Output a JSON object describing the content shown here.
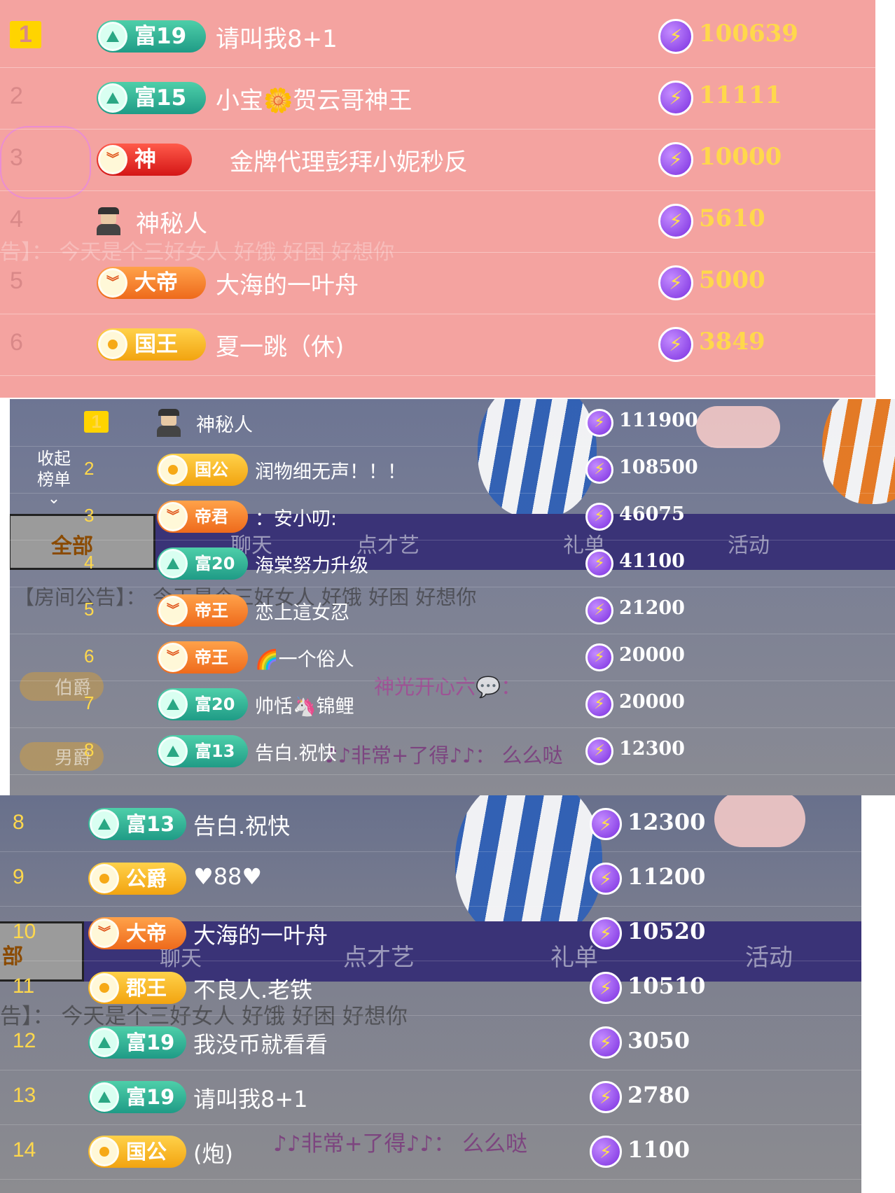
{
  "panel1": {
    "rows": [
      {
        "rank": "1",
        "badge": "富19",
        "badge_style": "teal",
        "name": "请叫我8+1",
        "score": "100639"
      },
      {
        "rank": "2",
        "badge": "富15",
        "badge_style": "teal",
        "name": "小宝🌼贺云哥神王",
        "score": "11111"
      },
      {
        "rank": "3",
        "badge": "神",
        "badge_style": "red",
        "name": "金牌代理彭拜小妮秒反",
        "score": "10000"
      },
      {
        "rank": "4",
        "badge": "",
        "badge_style": "mystery",
        "name": "神秘人",
        "score": "5610"
      },
      {
        "rank": "5",
        "badge": "大帝",
        "badge_style": "orange",
        "name": "大海的一叶舟",
        "score": "5000"
      },
      {
        "rank": "6",
        "badge": "国王",
        "badge_style": "gold",
        "name": "夏一跳（休)",
        "score": "3849"
      }
    ],
    "ghost_notice": "告】： 今天是个三好女人 好饿 好困 好想你"
  },
  "panel2": {
    "collapse_label": "收起\n榜单",
    "collapse_icon": "chevron-down-icon",
    "rows": [
      {
        "rank": "1",
        "badge": "",
        "badge_style": "mystery",
        "name": "神秘人",
        "score": "111900"
      },
      {
        "rank": "2",
        "badge": "国公",
        "badge_style": "gold",
        "name": "润物细无声！！！",
        "score": "108500"
      },
      {
        "rank": "3",
        "badge": "帝君",
        "badge_style": "orange",
        "name": "：安小叨:",
        "score": "46075"
      },
      {
        "rank": "4",
        "badge": "富20",
        "badge_style": "teal",
        "name": "海棠努力升级",
        "score": "41100"
      },
      {
        "rank": "5",
        "badge": "帝王",
        "badge_style": "orange",
        "name": "恋上這女忍",
        "score": "21200"
      },
      {
        "rank": "6",
        "badge": "帝王",
        "badge_style": "orange",
        "name": "🌈一个俗人",
        "score": "20000"
      },
      {
        "rank": "7",
        "badge": "富20",
        "badge_style": "teal",
        "name": "帅恬🦄锦鲤",
        "score": "20000"
      },
      {
        "rank": "8",
        "badge": "富13",
        "badge_style": "teal",
        "name": "告白.祝快",
        "score": "12300"
      }
    ],
    "tabs": {
      "all": "全部",
      "chat": "聊天",
      "talent": "点才艺",
      "gift": "礼单",
      "activity": "活动"
    },
    "notice": "【房间公告】： 今天是个三好女人 好饿 好困 好想你",
    "bg_chat_1": "神光开心六💬：",
    "bg_chat_2": "♪♪非常+了得♪♪： 么么哒",
    "bg_badge_1": "伯爵",
    "bg_badge_2": "男爵"
  },
  "panel3": {
    "rows": [
      {
        "rank": "8",
        "badge": "富13",
        "badge_style": "teal",
        "name": "告白.祝快",
        "score": "12300"
      },
      {
        "rank": "9",
        "badge": "公爵",
        "badge_style": "gold",
        "name": "♥88♥",
        "score": "11200"
      },
      {
        "rank": "10",
        "badge": "大帝",
        "badge_style": "orange",
        "name": "大海的一叶舟",
        "score": "10520"
      },
      {
        "rank": "11",
        "badge": "郡王",
        "badge_style": "gold",
        "name": "不良人.老铁",
        "score": "10510"
      },
      {
        "rank": "12",
        "badge": "富19",
        "badge_style": "teal",
        "name": "我没币就看看",
        "score": "3050"
      },
      {
        "rank": "13",
        "badge": "富19",
        "badge_style": "teal",
        "name": "请叫我8+1",
        "score": "2780"
      },
      {
        "rank": "14",
        "badge": "国公",
        "badge_style": "gold",
        "name": "(炮)",
        "score": "1100"
      }
    ],
    "tabs": {
      "all": "部",
      "chat": "聊天",
      "talent": "点才艺",
      "gift": "礼单",
      "activity": "活动"
    },
    "notice": "告】： 今天是个三好女人 好饿 好困 好想你",
    "bg_chat": "♪♪非常+了得♪♪： 么么哒"
  },
  "icons": {
    "score": "lightning-bolt-icon",
    "mystery": "mystery-man-icon"
  },
  "colors": {
    "panel1_bg": "#f4a3a0",
    "score_gold": "#ffd84c",
    "tab_bar": "#3a3377",
    "rank_first": "#ffd400"
  }
}
